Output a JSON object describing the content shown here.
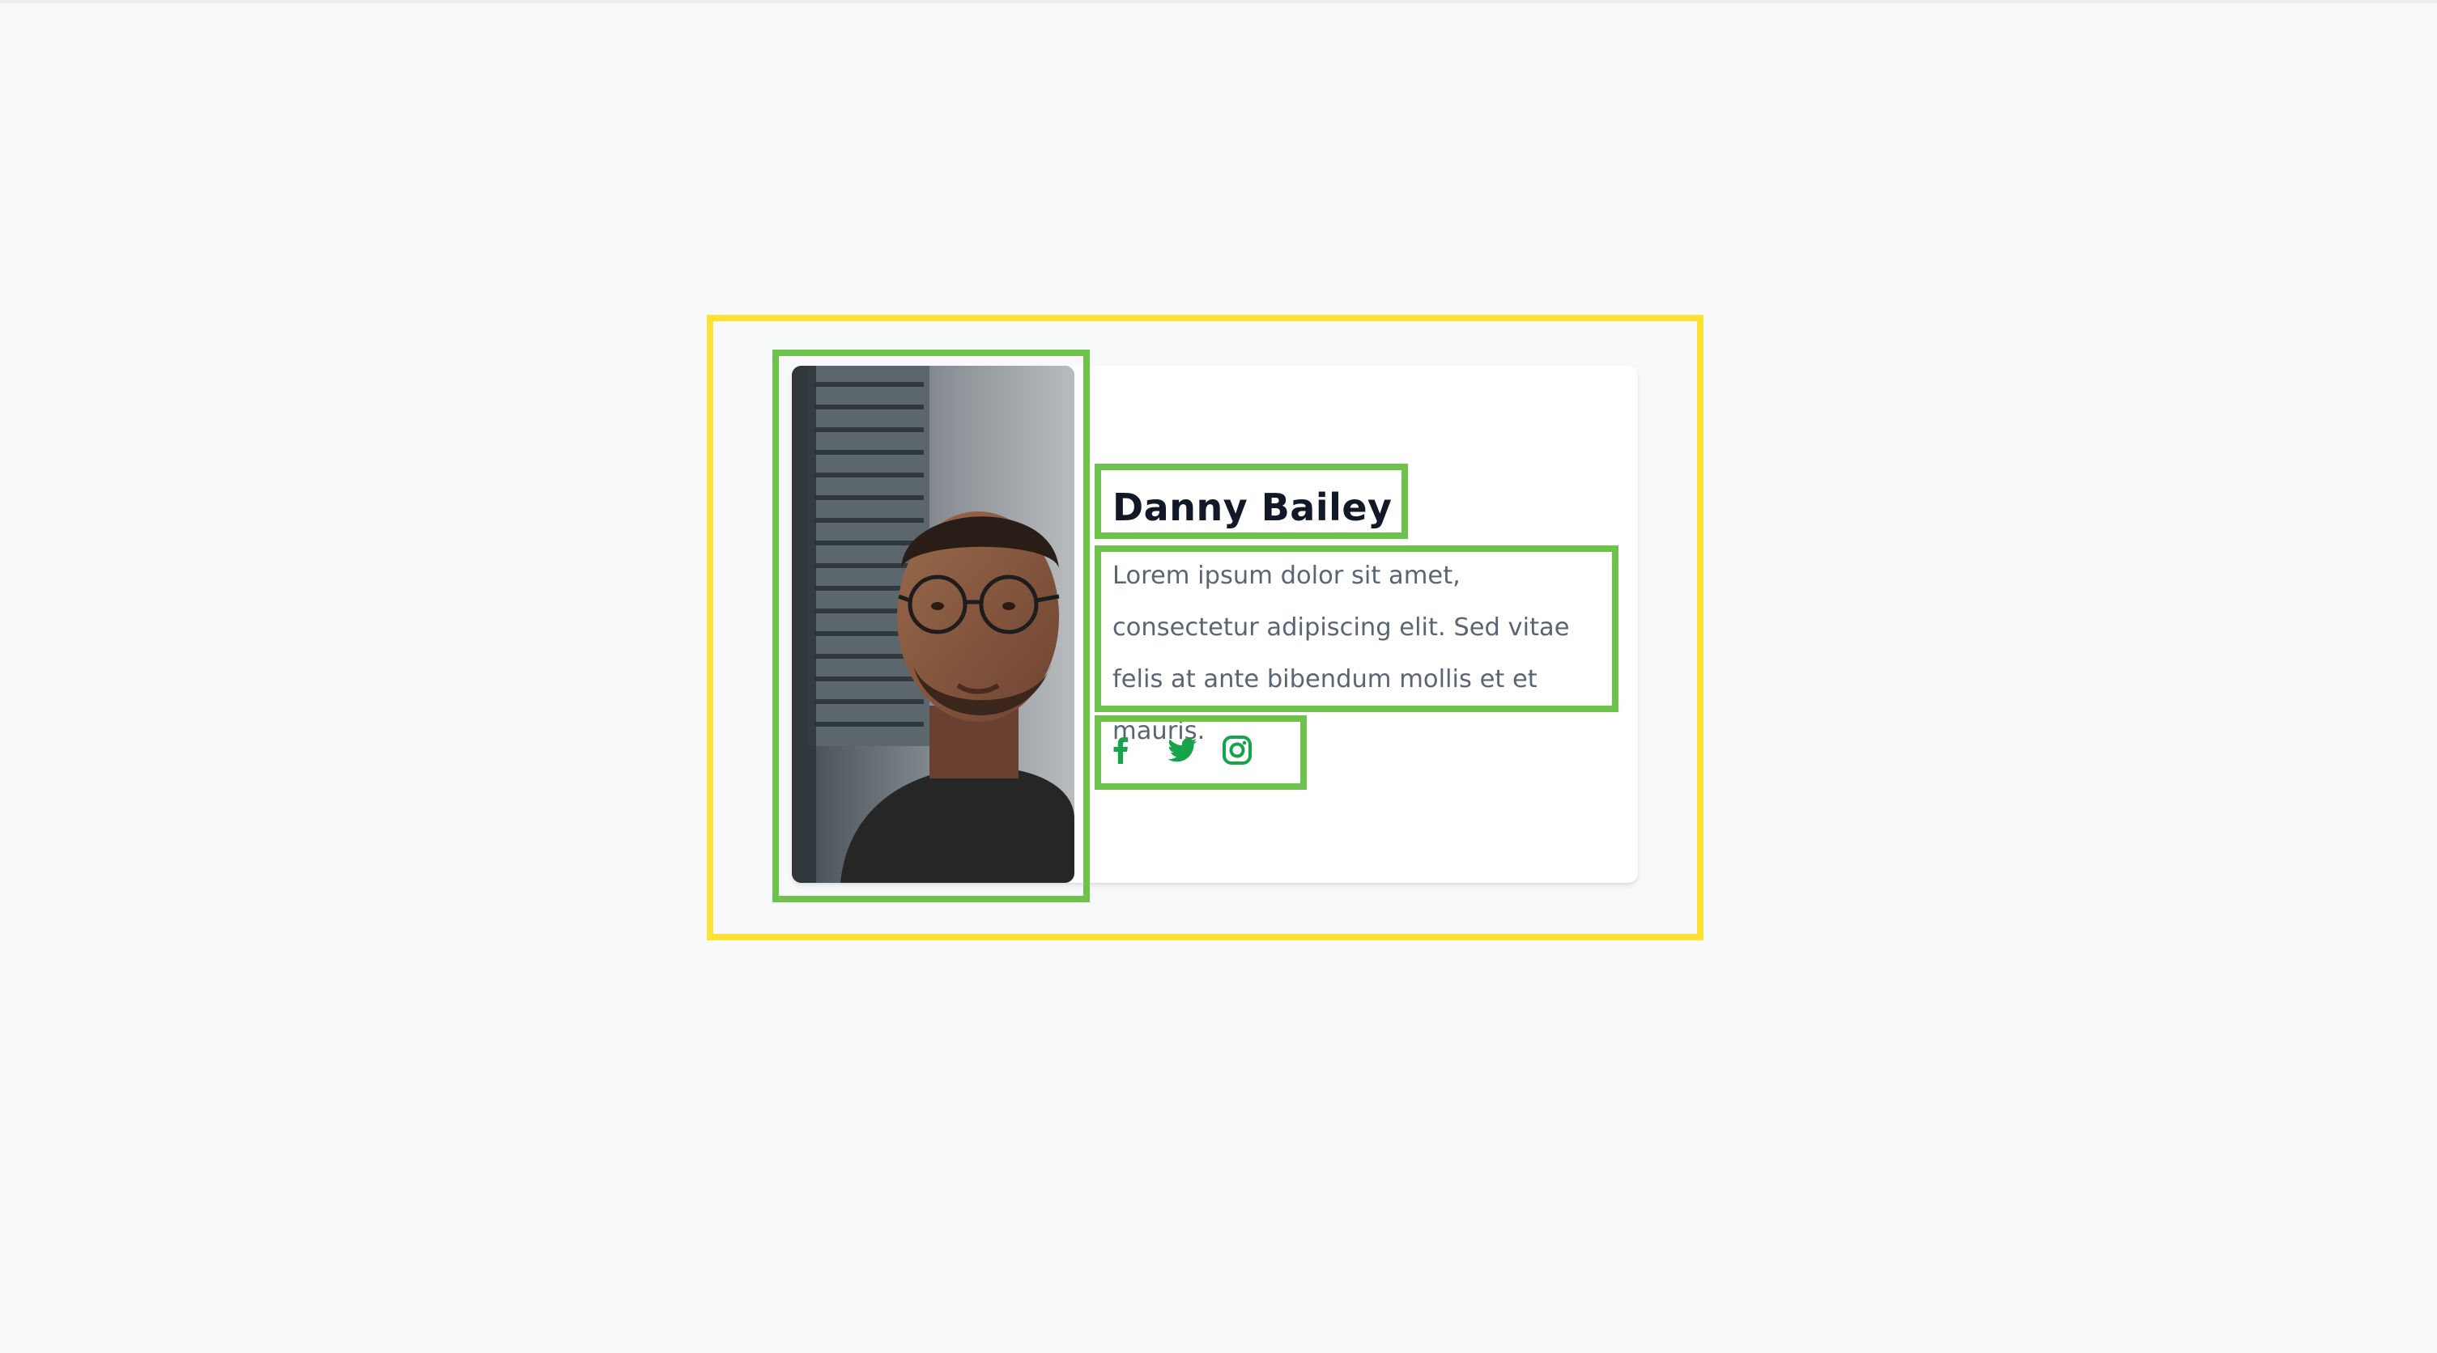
{
  "profile": {
    "name": "Danny Bailey",
    "bio": "Lorem ipsum dolor sit amet, consectetur adipiscing elit. Sed vitae felis at ante bibendum mollis et et mauris."
  },
  "socials": [
    {
      "network": "Facebook",
      "icon": "facebook-icon"
    },
    {
      "network": "Twitter",
      "icon": "twitter-icon"
    },
    {
      "network": "Instagram",
      "icon": "instagram-icon"
    }
  ],
  "colors": {
    "page_background": "#f8f9fa",
    "card_background": "#ffffff",
    "name_text": "#111827",
    "bio_text": "#5b6473",
    "social_icon": "#16a34a",
    "annotation_outer": "#ffe133",
    "annotation_inner": "#6cc24a"
  }
}
